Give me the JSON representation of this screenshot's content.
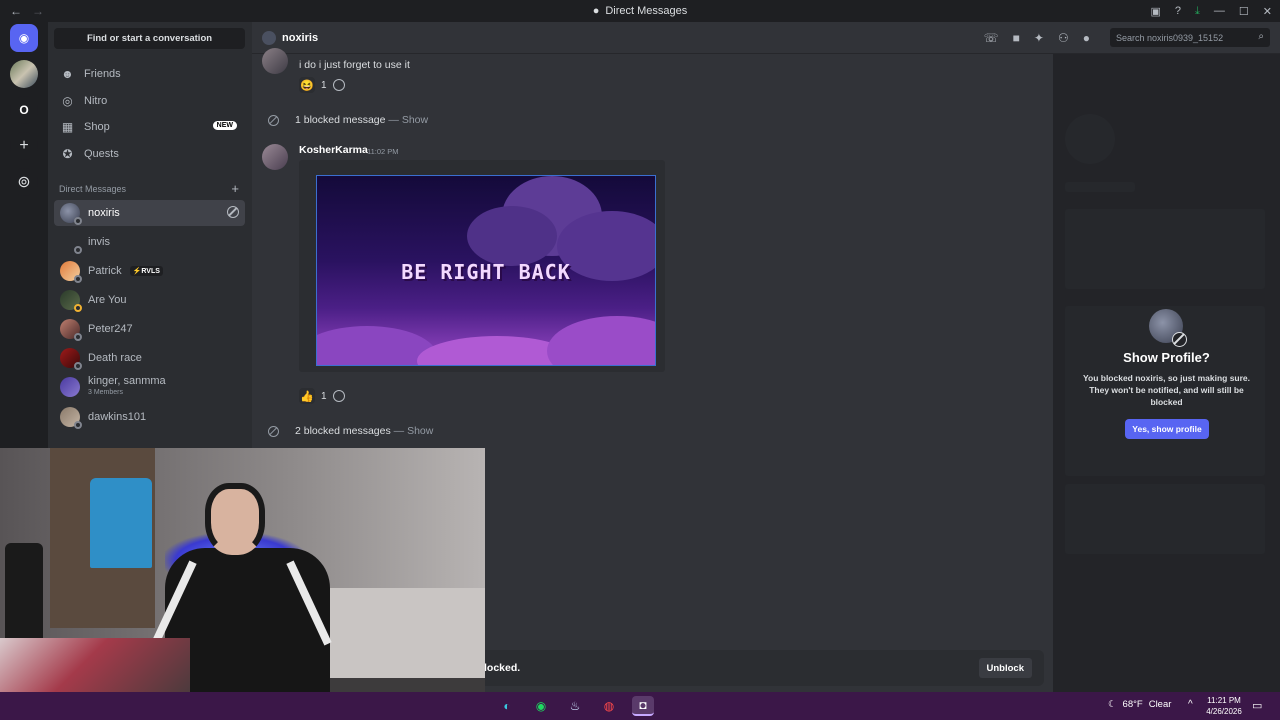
{
  "titlebar": {
    "title": "Direct Messages",
    "back": "←",
    "forward": "→"
  },
  "sidebar": {
    "find": "Find or start a conversation",
    "nav": [
      {
        "label": "Friends",
        "icon": "friends-icon"
      },
      {
        "label": "Nitro",
        "icon": "nitro-icon"
      },
      {
        "label": "Shop",
        "icon": "shop-icon",
        "badge": "NEW"
      },
      {
        "label": "Quests",
        "icon": "quests-icon"
      }
    ],
    "dm_header": "Direct Messages",
    "dms": [
      {
        "name": "noxiris"
      },
      {
        "name": "invis"
      },
      {
        "name": "Patrick",
        "tag": "RVLS"
      },
      {
        "name": "Are You"
      },
      {
        "name": "Peter247"
      },
      {
        "name": "Death race"
      },
      {
        "name": "kinger, sanmma",
        "sub": "3 Members"
      },
      {
        "name": "dawkins101"
      }
    ]
  },
  "rail": {
    "server_letter": "O"
  },
  "header": {
    "channel": "noxiris",
    "search_placeholder": "Search noxiris0939_15152"
  },
  "chat": {
    "msg1": "i do i just forget to use it",
    "react1_count": "1",
    "blocked1": "1 blocked message",
    "blocked_sep": "—",
    "show": "Show",
    "user": "KosherKarma",
    "time": "11:02 PM",
    "embed_text": "BE RIGHT BACK",
    "react2_count": "1",
    "blocked2": "2 blocked messages"
  },
  "blockbar": {
    "text": "locked.",
    "button": "Unblock"
  },
  "panel": {
    "title": "Show Profile?",
    "desc": "You blocked noxiris, so just making sure. They won't be notified, and will still be blocked",
    "button": "Yes, show profile"
  },
  "taskbar": {
    "weather": "68°F",
    "condition": "Clear",
    "time": "11:21 PM",
    "date": "4/26/2026"
  },
  "colors": {
    "accent": "#5865f2",
    "bg": "#313338",
    "sidebar": "#2b2d31",
    "taskbar": "#3b1748"
  }
}
